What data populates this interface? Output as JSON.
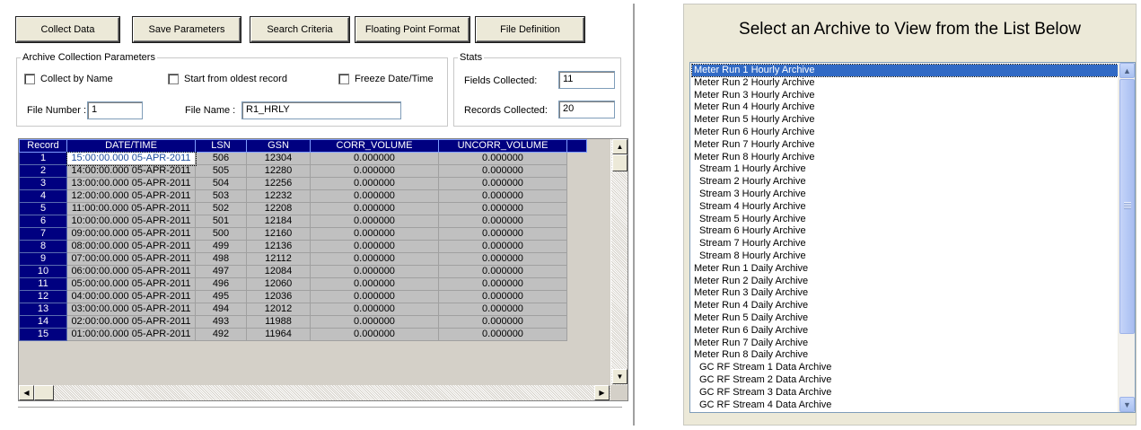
{
  "toolbar": {
    "buttons": [
      {
        "id": "collect",
        "label": "Collect Data"
      },
      {
        "id": "save",
        "label": "Save Parameters"
      },
      {
        "id": "search",
        "label": "Search Criteria"
      },
      {
        "id": "float",
        "label": "Floating Point Format"
      },
      {
        "id": "filedef",
        "label": "File Definition"
      }
    ]
  },
  "params": {
    "legend": "Archive Collection Parameters",
    "collect_by_name": "Collect by Name",
    "start_oldest": "Start from oldest record",
    "freeze": "Freeze Date/Time",
    "file_number_label": "File Number :",
    "file_number_value": "1",
    "file_name_label": "File Name :",
    "file_name_value": "R1_HRLY"
  },
  "stats": {
    "legend": "Stats",
    "fields_label": "Fields Collected:",
    "fields_value": "11",
    "records_label": "Records Collected:",
    "records_value": "20"
  },
  "grid": {
    "columns": [
      "Record",
      "DATE/TIME",
      "LSN",
      "GSN",
      "CORR_VOLUME",
      "UNCORR_VOLUME"
    ],
    "rows": [
      [
        "1",
        "15:00:00.000 05-APR-2011",
        "506",
        "12304",
        "0.000000",
        "0.000000"
      ],
      [
        "2",
        "14:00:00.000 05-APR-2011",
        "505",
        "12280",
        "0.000000",
        "0.000000"
      ],
      [
        "3",
        "13:00:00.000 05-APR-2011",
        "504",
        "12256",
        "0.000000",
        "0.000000"
      ],
      [
        "4",
        "12:00:00.000 05-APR-2011",
        "503",
        "12232",
        "0.000000",
        "0.000000"
      ],
      [
        "5",
        "11:00:00.000 05-APR-2011",
        "502",
        "12208",
        "0.000000",
        "0.000000"
      ],
      [
        "6",
        "10:00:00.000 05-APR-2011",
        "501",
        "12184",
        "0.000000",
        "0.000000"
      ],
      [
        "7",
        "09:00:00.000 05-APR-2011",
        "500",
        "12160",
        "0.000000",
        "0.000000"
      ],
      [
        "8",
        "08:00:00.000 05-APR-2011",
        "499",
        "12136",
        "0.000000",
        "0.000000"
      ],
      [
        "9",
        "07:00:00.000 05-APR-2011",
        "498",
        "12112",
        "0.000000",
        "0.000000"
      ],
      [
        "10",
        "06:00:00.000 05-APR-2011",
        "497",
        "12084",
        "0.000000",
        "0.000000"
      ],
      [
        "11",
        "05:00:00.000 05-APR-2011",
        "496",
        "12060",
        "0.000000",
        "0.000000"
      ],
      [
        "12",
        "04:00:00.000 05-APR-2011",
        "495",
        "12036",
        "0.000000",
        "0.000000"
      ],
      [
        "13",
        "03:00:00.000 05-APR-2011",
        "494",
        "12012",
        "0.000000",
        "0.000000"
      ],
      [
        "14",
        "02:00:00.000 05-APR-2011",
        "493",
        "11988",
        "0.000000",
        "0.000000"
      ],
      [
        "15",
        "01:00:00.000 05-APR-2011",
        "492",
        "11964",
        "0.000000",
        "0.000000"
      ]
    ]
  },
  "archive": {
    "title": "Select an Archive to View from the List Below",
    "items": [
      "Meter Run 1 Hourly Archive",
      "Meter Run 2 Hourly Archive",
      "Meter Run 3 Hourly Archive",
      "Meter Run 4 Hourly Archive",
      "Meter Run 5 Hourly Archive",
      "Meter Run 6 Hourly Archive",
      "Meter Run 7 Hourly Archive",
      "Meter Run 8 Hourly Archive",
      " Stream 1 Hourly Archive",
      " Stream 2 Hourly Archive",
      " Stream 3 Hourly Archive",
      " Stream 4 Hourly Archive",
      " Stream 5 Hourly Archive",
      " Stream 6 Hourly Archive",
      " Stream 7 Hourly Archive",
      " Stream 8 Hourly Archive",
      "Meter Run 1 Daily Archive",
      "Meter Run 2 Daily Archive",
      "Meter Run 3 Daily Archive",
      "Meter Run 4 Daily Archive",
      "Meter Run 5 Daily Archive",
      "Meter Run 6 Daily Archive",
      "Meter Run 7 Daily Archive",
      "Meter Run 8 Daily Archive",
      " GC RF Stream 1 Data Archive",
      " GC RF Stream 2 Data Archive",
      " GC RF Stream 3 Data Archive",
      " GC RF Stream 4 Data Archive"
    ]
  },
  "colors": {
    "grid_header": "#000080",
    "selection": "#316ac5",
    "cell_bg": "#c0c0c0"
  }
}
